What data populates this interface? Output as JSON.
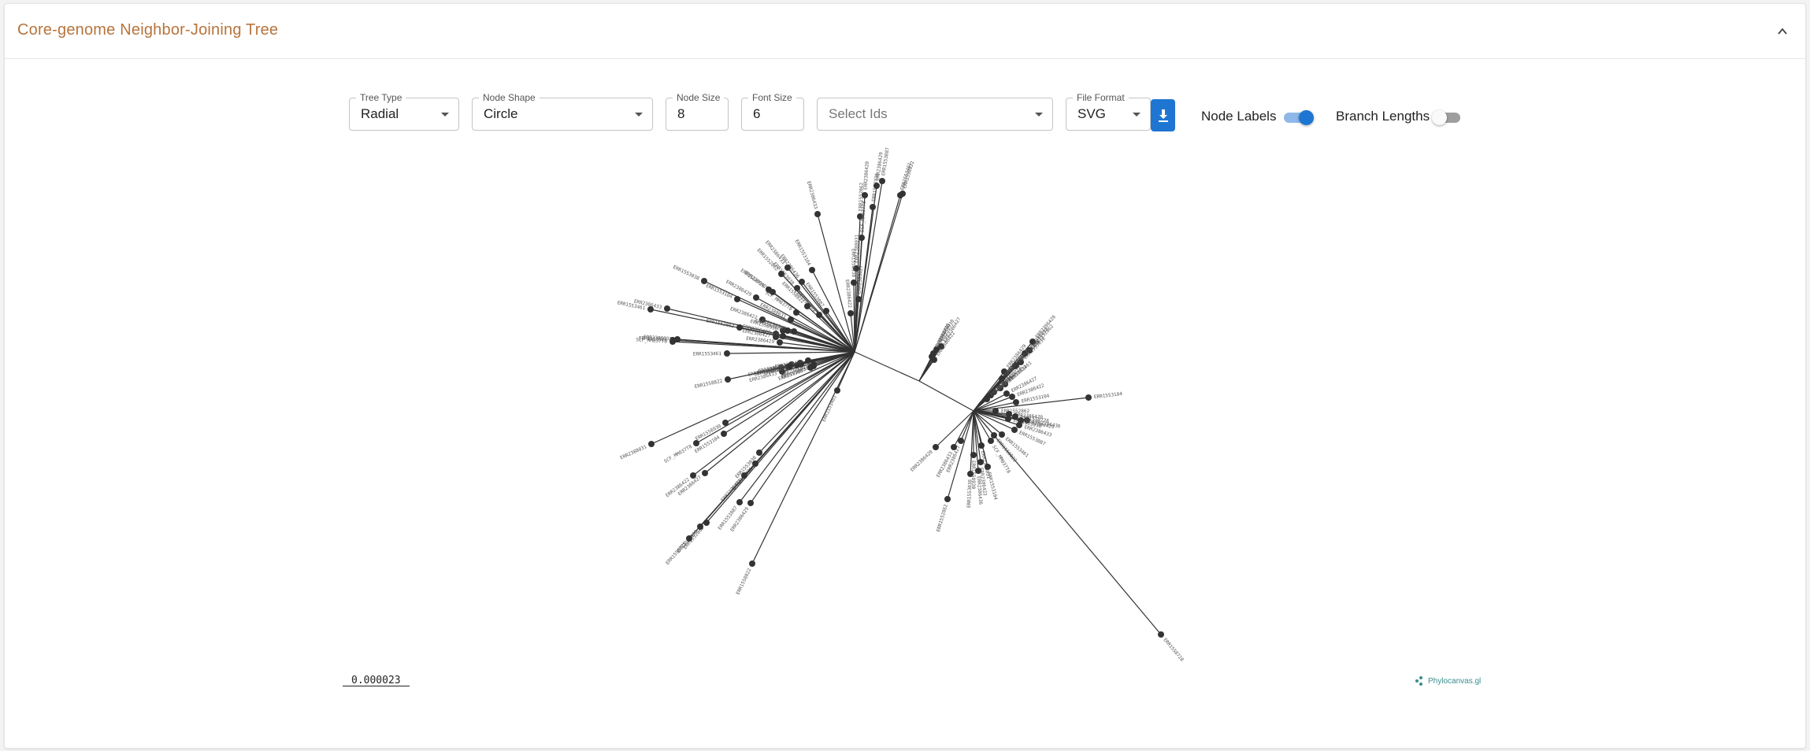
{
  "header": {
    "title": "Core-genome Neighbor-Joining Tree"
  },
  "controls": {
    "tree_type": {
      "label": "Tree Type",
      "value": "Radial"
    },
    "node_shape": {
      "label": "Node Shape",
      "value": "Circle"
    },
    "node_size": {
      "label": "Node Size",
      "value": "8"
    },
    "font_size": {
      "label": "Font Size",
      "value": "6"
    },
    "select_ids": {
      "placeholder": "Select Ids"
    },
    "file_format": {
      "label": "File Format",
      "value": "SVG"
    },
    "node_labels": {
      "label": "Node Labels",
      "enabled": true
    },
    "branch_lengths": {
      "label": "Branch Lengths",
      "enabled": false
    }
  },
  "tree": {
    "scale_label": "0.000023",
    "watermark": "Phylocanvas.gl",
    "leaf_labels": [
      "ERR2386433",
      "ERR1552862",
      "ERR2386420",
      "ERR1558728",
      "ERR2386429",
      "ERR1553087",
      "ERR1553461",
      "ERR1558822",
      "SCF_MM037T8",
      "ERR2388031",
      "ERR1558930",
      "ERR2386427",
      "ERR2386422",
      "ERR1553104",
      "ERR2386436",
      "ERR1553038"
    ]
  },
  "colors": {
    "title": "#b7743c",
    "accent": "#1e76d2",
    "tree": "#333333"
  }
}
